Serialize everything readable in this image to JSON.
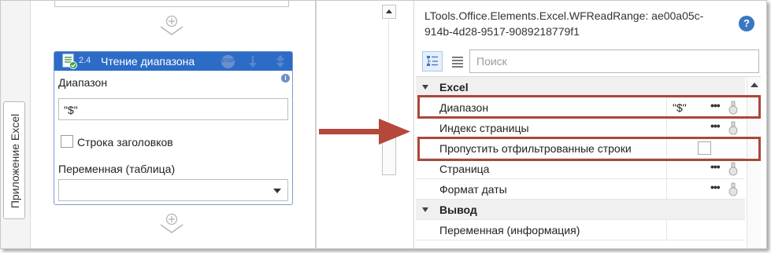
{
  "side_panel": {
    "label": "Приложение Excel"
  },
  "activity": {
    "number": "2.4",
    "title": "Чтение диапазона",
    "stop_badge": "STOP",
    "info_glyph": "i",
    "range_label": "Диапазон",
    "range_value": "\"$\"",
    "header_row_label": "Строка заголовков",
    "header_row_checked": false,
    "variable_label": "Переменная (таблица)",
    "variable_value": ""
  },
  "properties": {
    "title": "LTools.Office.Elements.Excel.WFReadRange: ae00a05c-914b-4d28-9517-9089218779f1",
    "help_glyph": "?",
    "search_placeholder": "Поиск",
    "dots": "•••",
    "categories": [
      {
        "name": "Excel",
        "rows": [
          {
            "name": "Диапазон",
            "value": "\"$\"",
            "kind": "text",
            "highlighted": true
          },
          {
            "name": "Индекс страницы",
            "value": "",
            "kind": "text",
            "highlighted": false
          },
          {
            "name": "Пропустить отфильтрованные строки",
            "value": "",
            "kind": "checkbox",
            "checked": false,
            "highlighted": true
          },
          {
            "name": "Страница",
            "value": "",
            "kind": "text",
            "highlighted": false
          },
          {
            "name": "Формат даты",
            "value": "",
            "kind": "text",
            "highlighted": false
          }
        ]
      },
      {
        "name": "Вывод",
        "rows": [
          {
            "name": "Переменная (информация)",
            "value": "",
            "kind": "text",
            "highlighted": false
          }
        ]
      }
    ]
  },
  "colors": {
    "activity_header": "#2d6cc6",
    "highlight_border": "#a9483b",
    "arrow": "#b4483a",
    "help_icon": "#3a77c2"
  }
}
